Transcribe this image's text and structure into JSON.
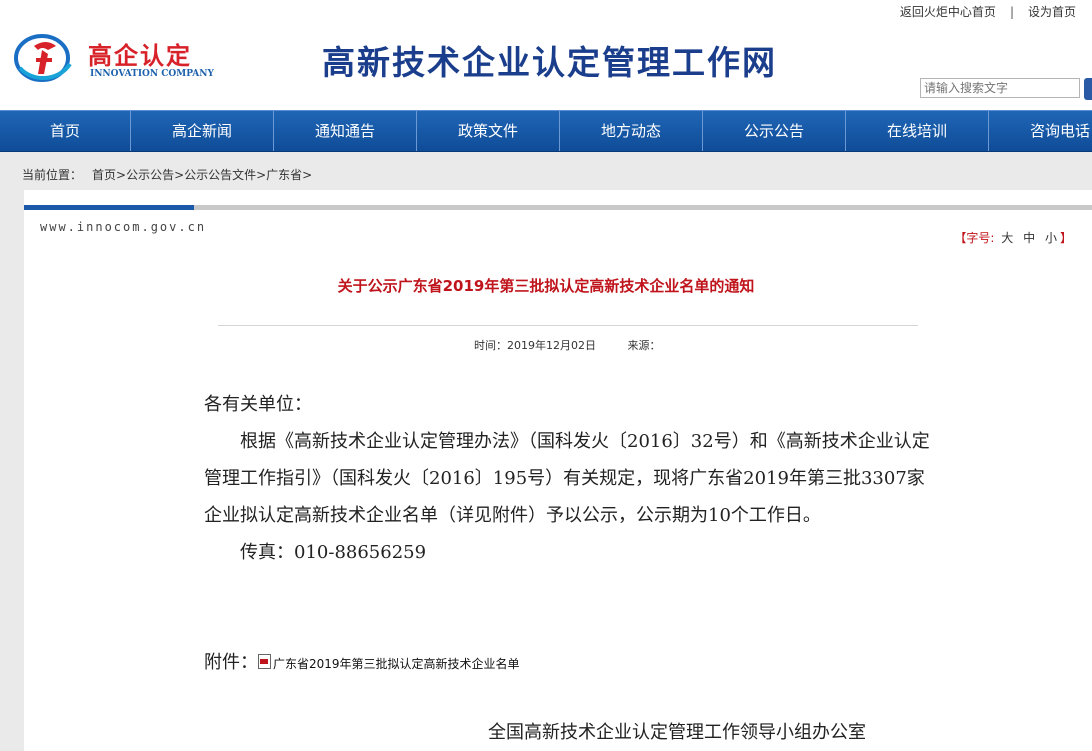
{
  "header": {
    "toplinks": [
      "返回火炬中心首页",
      "设为首页"
    ],
    "logo_text": "高企认定",
    "logo_en": "INNOVATION COMPANY",
    "site_title": "高新技术企业认定管理工作网",
    "search": {
      "placeholder": "请输入搜索文字"
    }
  },
  "nav": [
    "首页",
    "高企新闻",
    "通知通告",
    "政策文件",
    "地方动态",
    "公示公告",
    "在线培训",
    "咨询电话"
  ],
  "breadcrumb": {
    "label": "当前位置：",
    "path": "首页>公示公告>公示公告文件>广东省>"
  },
  "article": {
    "domain": "www.innocom.gov.cn",
    "font_size": {
      "open": "【字号:",
      "large": "大",
      "medium": "中",
      "small": "小",
      "close": "】"
    },
    "title": "关于公示广东省2019年第三批拟认定高新技术企业名单的通知",
    "time_label": "时间：",
    "time_value": "2019年12月02日",
    "source_label": "来源：",
    "salutation": "各有关单位：",
    "paragraph": "根据《高新技术企业认定管理办法》（国科发火〔2016〕32号）和《高新技术企业认定管理工作指引》（国科发火〔2016〕195号）有关规定，现将广东省2019年第三批3307家企业拟认定高新技术企业名单（详见附件）予以公示，公示期为10个工作日。",
    "fax": "传真：010-88656259",
    "attachment_label": "附件：",
    "attachment_link": "广东省2019年第三批拟认定高新技术企业名单",
    "signature": "全国高新技术企业认定管理工作领导小组办公室"
  },
  "colors": {
    "nav": "#1a5cae",
    "title_red": "#c0141c",
    "site_title_blue": "#1a3d8c"
  }
}
